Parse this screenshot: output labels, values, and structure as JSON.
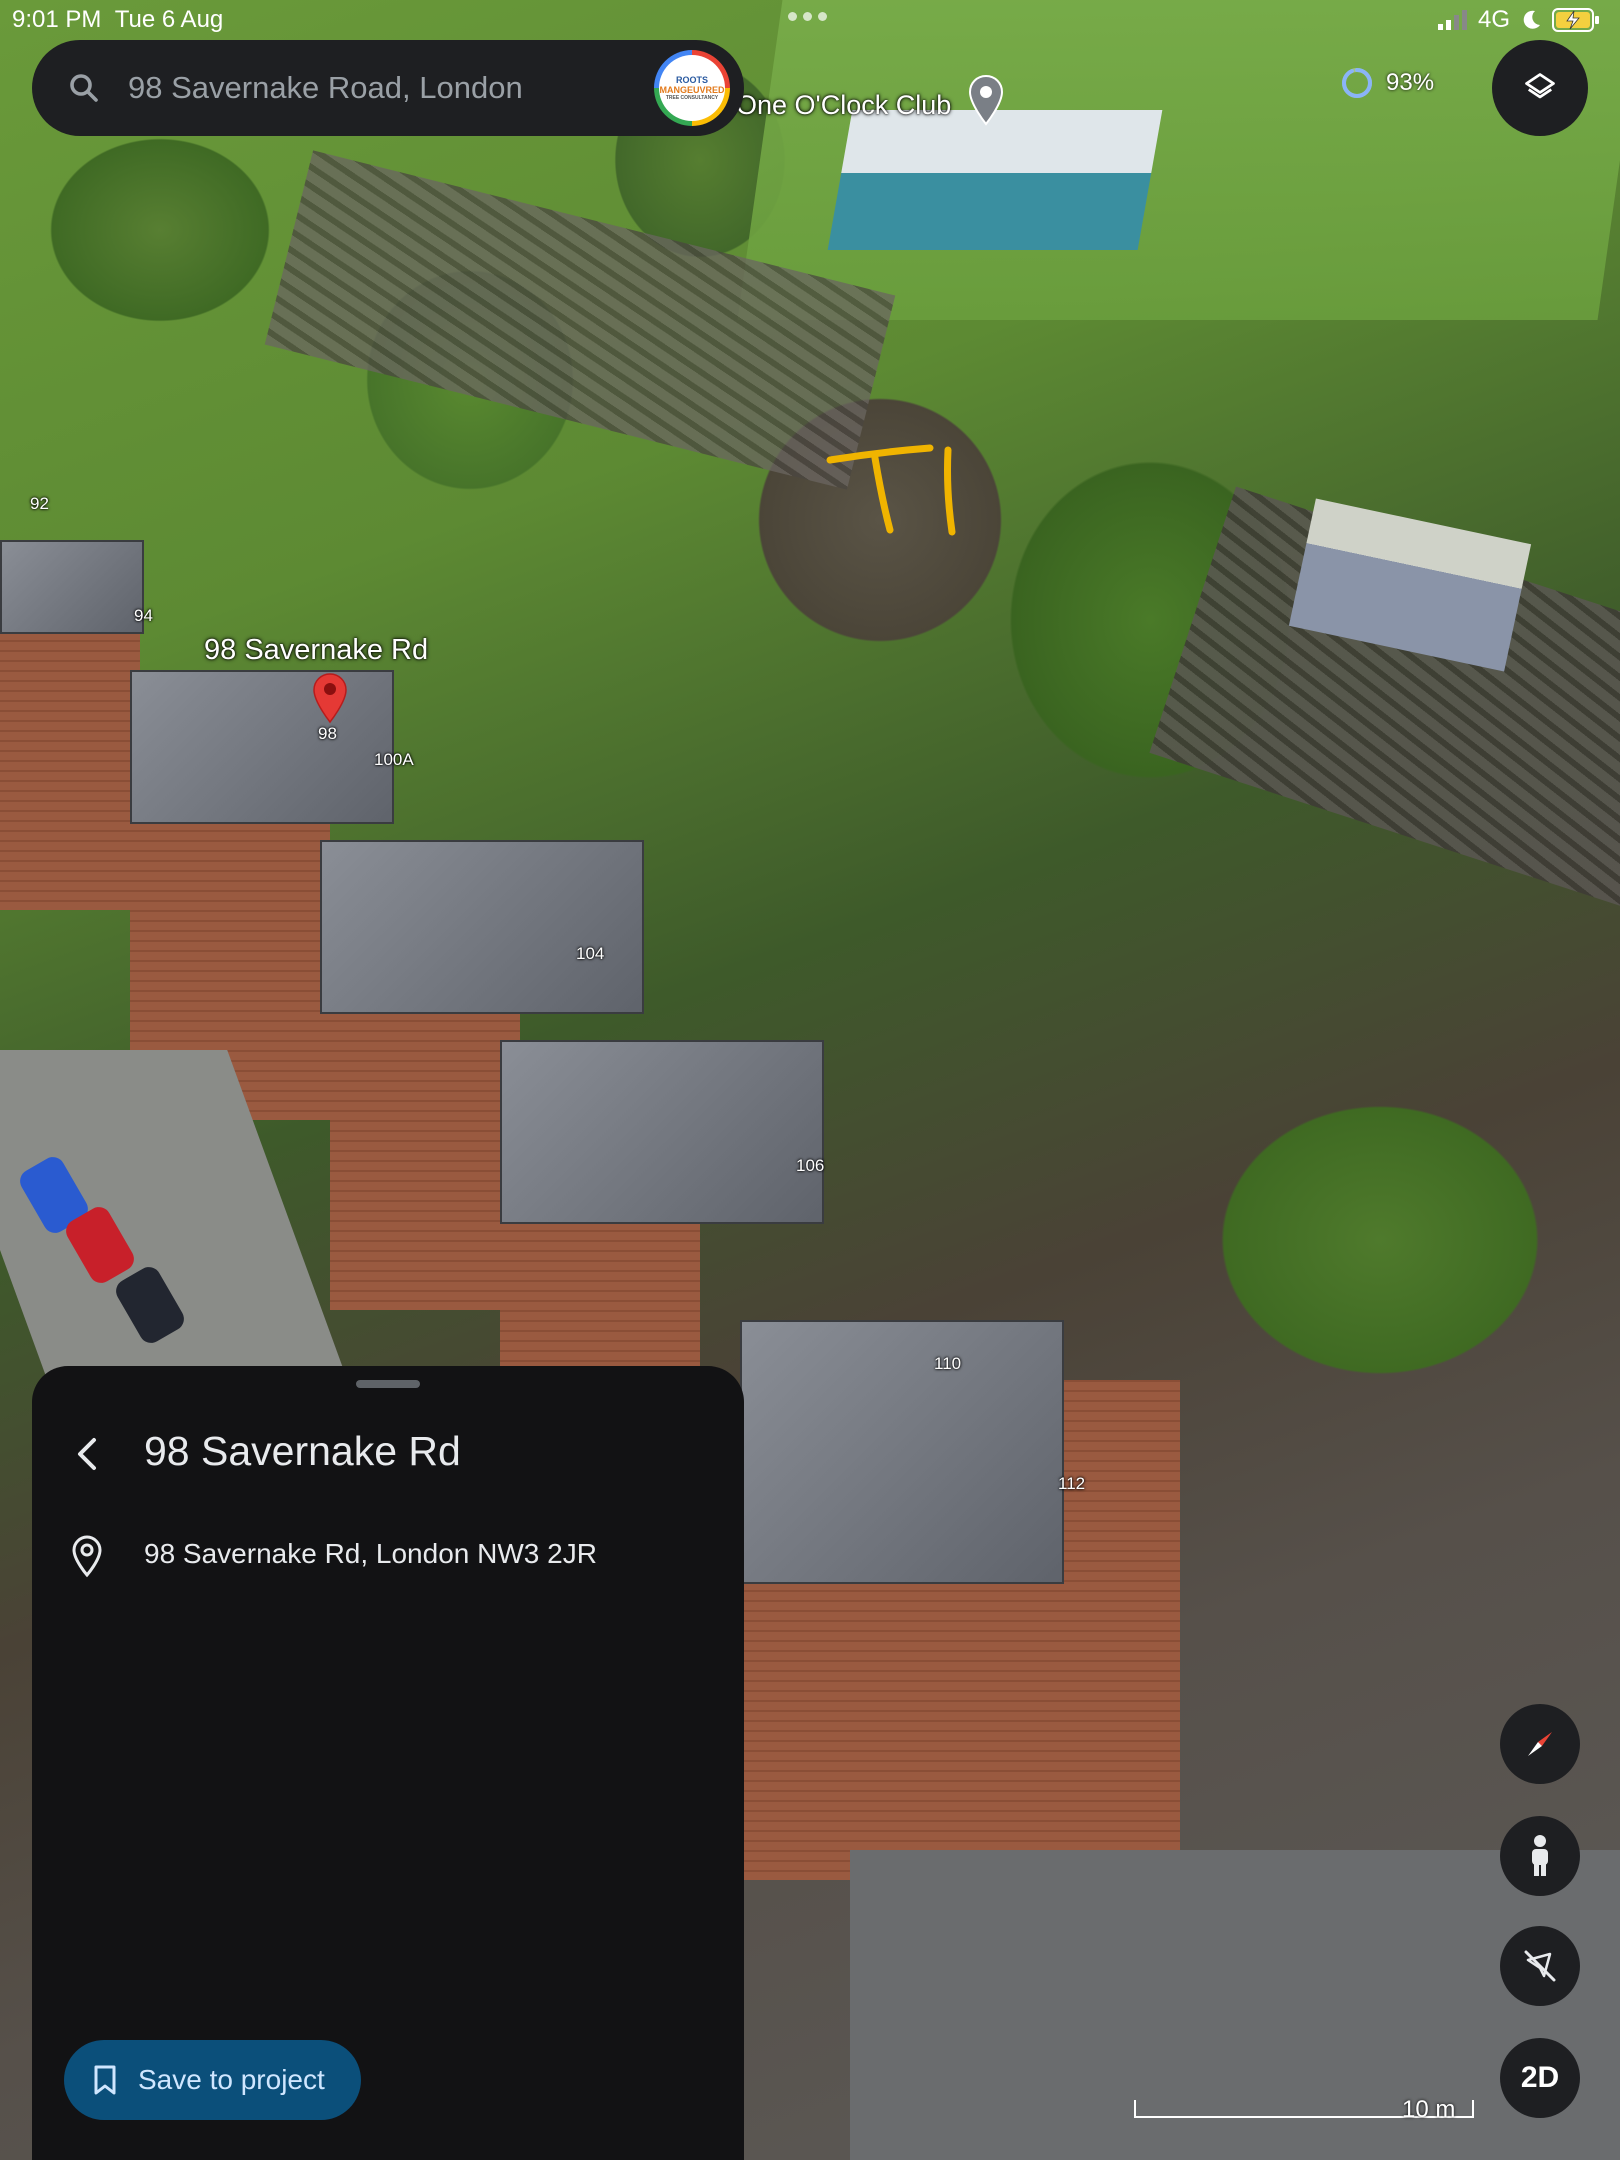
{
  "status_bar": {
    "time": "9:01 PM",
    "date": "Tue 6 Aug",
    "network": "4G"
  },
  "search": {
    "placeholder": "98 Savernake Road, London",
    "icon": "search-icon"
  },
  "account": {
    "avatar_line1": "ROOTS",
    "avatar_line2": "MANGEUVRED",
    "avatar_line3": "TREE CONSULTANCY"
  },
  "loading": {
    "percent_label": "93%",
    "progress": 0.93
  },
  "map": {
    "poi_label": "One O'Clock Club",
    "place_label": "98 Savernake Rd",
    "pin_number": "98",
    "house_numbers": [
      "92",
      "94",
      "100A",
      "104",
      "106",
      "110",
      "112"
    ],
    "annotation": "T1",
    "scale_label": "10 m"
  },
  "controls": {
    "layers": "layers-icon",
    "compass": "compass-icon",
    "pegman": "pegman-icon",
    "tilt": "tilt-off-icon",
    "view_mode": "2D"
  },
  "place_sheet": {
    "title": "98 Savernake Rd",
    "address": "98 Savernake Rd, London NW3 2JR",
    "save_label": "Save to project"
  },
  "colors": {
    "pin": "#e53935",
    "sheet_bg": "#121214",
    "save_button": "#0b4f7a",
    "annotation": "#f0b400"
  }
}
